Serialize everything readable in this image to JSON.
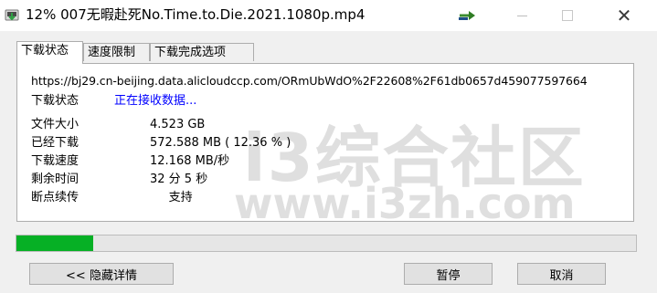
{
  "window": {
    "title": "12% 007无暇赴死No.Time.to.Die.2021.1080p.mp4",
    "close_glyph": "✕"
  },
  "tabs": [
    {
      "label": "下载状态",
      "active": true
    },
    {
      "label": "速度限制",
      "active": false
    },
    {
      "label": "下载完成选项",
      "active": false
    }
  ],
  "download": {
    "url": "https://bj29.cn-beijing.data.alicloudccp.com/ORmUbWdO%2F22608%2F61db0657d459077597664",
    "status_label": "下载状态",
    "status_value": "正在接收数据...",
    "rows": [
      {
        "label": "文件大小",
        "value": "4.523  GB"
      },
      {
        "label": "已经下载",
        "value": "572.588  MB  ( 12.36 % )"
      },
      {
        "label": "下载速度",
        "value": "12.168  MB/秒"
      },
      {
        "label": "剩余时间",
        "value": "32 分 5 秒"
      },
      {
        "label": "断点续传",
        "value": "     支持"
      }
    ],
    "progress_fraction": 0.1236
  },
  "watermark": {
    "text_cn": "i3综合社区",
    "text_url": "www.i3zh.com"
  },
  "buttons": {
    "hide_details": "<< 隐藏详情",
    "pause": "暂停",
    "cancel": "取消"
  },
  "colors": {
    "progress": "#06b025",
    "status": "#0000ff"
  },
  "icons": {
    "app": "download-manager-icon",
    "extra": "green-arrow-icon"
  }
}
